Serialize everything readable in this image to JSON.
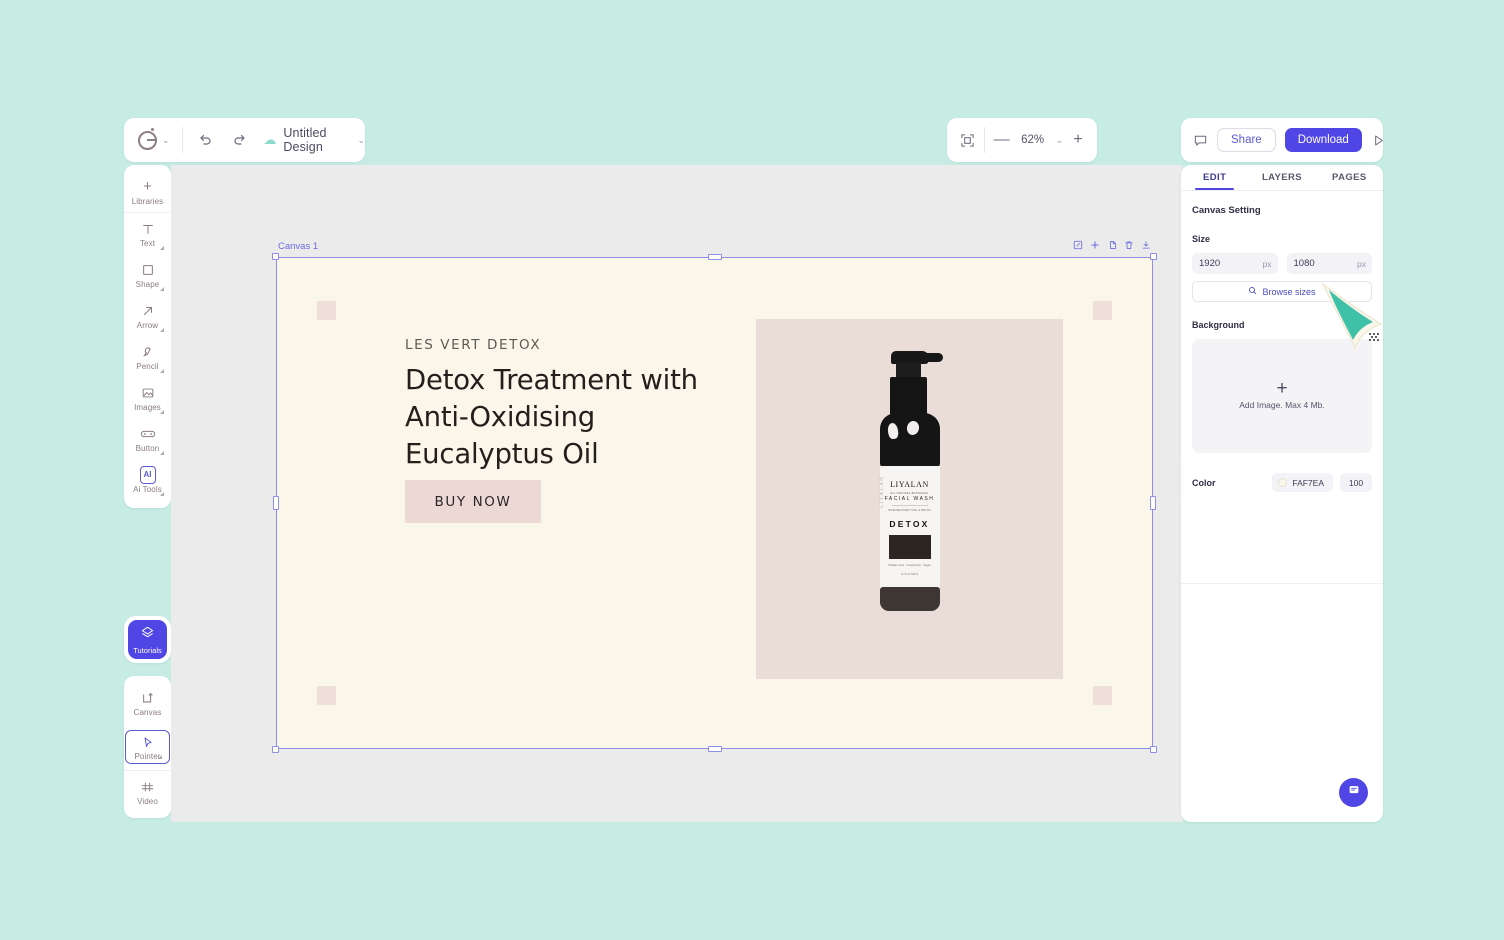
{
  "app": {
    "logo_icon": "brand-g-logo",
    "document_title": "Untitled Design",
    "cloud_icon": "cloud-sync-icon",
    "undo_icon": "undo-arrow-icon",
    "redo_icon": "redo-arrow-icon",
    "chevron_icon": "chevron-down-icon"
  },
  "zoombar": {
    "fit_icon": "fit-to-screen-icon",
    "minus_label": "—",
    "value": "62%",
    "chevron": "⌄",
    "plus_label": "+"
  },
  "actions": {
    "comment_icon": "comment-icon",
    "share_label": "Share",
    "download_label": "Download",
    "present_icon": "play-present-icon"
  },
  "tools_top": [
    {
      "label": "Libraries",
      "icon": "plus-icon",
      "expandable": false
    },
    {
      "label": "Text",
      "icon": "text-t-icon",
      "expandable": true
    },
    {
      "label": "Shape",
      "icon": "square-shape-icon",
      "expandable": true
    },
    {
      "label": "Arrow",
      "icon": "arrow-up-right-icon",
      "expandable": true
    },
    {
      "label": "Pencil",
      "icon": "pencil-icon",
      "expandable": true
    },
    {
      "label": "Images",
      "icon": "image-icon",
      "expandable": true
    },
    {
      "label": "Button",
      "icon": "button-icon",
      "expandable": true
    },
    {
      "label": "Ai Tools",
      "icon": "ai-badge-icon",
      "expandable": true
    }
  ],
  "tutorials": {
    "label": "Tutorials",
    "icon": "layers-diamond-icon"
  },
  "tools_bottom": [
    {
      "label": "Canvas",
      "icon": "canvas-frame-icon",
      "selected": false,
      "expandable": false
    },
    {
      "label": "Pointer",
      "icon": "pointer-cursor-icon",
      "selected": true,
      "expandable": true
    },
    {
      "label": "Video",
      "icon": "video-timeline-icon",
      "selected": false,
      "expandable": false
    }
  ],
  "frame": {
    "name": "Canvas 1",
    "tools": [
      {
        "icon": "rename-frame-icon"
      },
      {
        "icon": "add-frame-icon"
      },
      {
        "icon": "duplicate-frame-icon"
      },
      {
        "icon": "delete-frame-icon"
      },
      {
        "icon": "download-frame-icon"
      }
    ]
  },
  "artboard": {
    "background_color": "#FAF7EA",
    "kicker": "LES VERT DETOX",
    "headline": "Detox Treatment with Anti-Oxidising Eucalyptus Oil",
    "cta_label": "BUY NOW",
    "cta_color": "#ECD9D6",
    "product_panel_color": "#EADCD6",
    "decor_square_color": "#EEDFD9",
    "product": {
      "brand": "LIYALAN",
      "subtitle_small": "ALL NATURAL BOTANICAL",
      "subtitle": "FACIAL WASH",
      "tagline": "INTENSE PURIFYING & DETOX",
      "variant": "DETOX",
      "footer_lines": "Paraben Free · Cruelty-Free · Vegan",
      "volume": "3.7 fl oz 100ml",
      "vertical_text": "LIYALAN"
    }
  },
  "right_panel": {
    "tabs": [
      {
        "label": "EDIT",
        "active": true
      },
      {
        "label": "LAYERS",
        "active": false
      },
      {
        "label": "PAGES",
        "active": false
      }
    ],
    "section_title": "Canvas Setting",
    "size_label": "Size",
    "width_value": "1920",
    "width_unit": "px",
    "height_value": "1080",
    "height_unit": "px",
    "browse_sizes_label": "Browse sizes",
    "browse_icon": "search-sizes-icon",
    "background_label": "Background",
    "dropzone_text": "Add Image. Max 4 Mb.",
    "dropzone_icon": "plus-icon",
    "color_label": "Color",
    "color_hex": "FAF7EA",
    "color_opacity": "100",
    "collapse_icon": "chevron-right-icon"
  },
  "chat": {
    "icon": "chat-support-icon"
  },
  "colors": {
    "accent": "#4F46E5",
    "page_background": "#C6ECE4",
    "stage_background": "#EBEBEB",
    "cursor_graphic": "#3EC1A6"
  }
}
